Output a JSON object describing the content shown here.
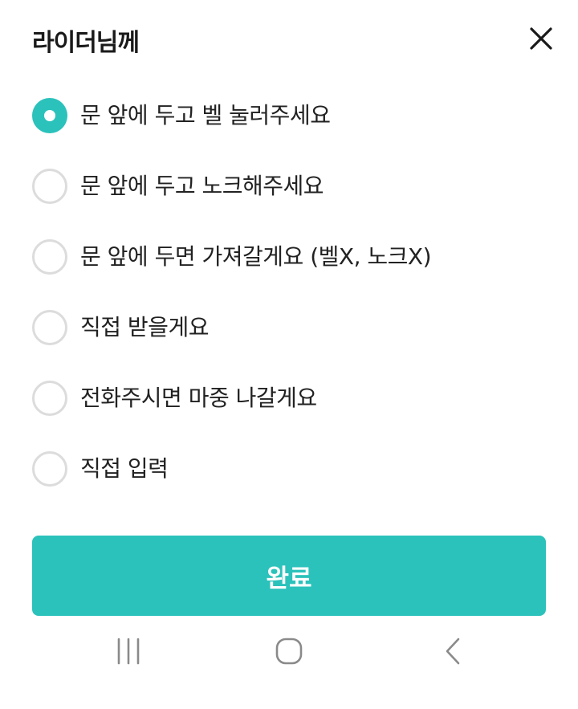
{
  "sheet": {
    "title": "라이더님께",
    "close_icon": "close-icon"
  },
  "options": [
    {
      "label": "문 앞에 두고 벨 눌러주세요",
      "selected": true
    },
    {
      "label": "문 앞에 두고 노크해주세요",
      "selected": false
    },
    {
      "label": "문 앞에 두면 가져갈게요 (벨X, 노크X)",
      "selected": false
    },
    {
      "label": "직접 받을게요",
      "selected": false
    },
    {
      "label": "전화주시면 마중 나갈게요",
      "selected": false
    },
    {
      "label": "직접 입력",
      "selected": false
    }
  ],
  "confirm": {
    "label": "완료"
  },
  "navbar": {
    "recents_icon": "recents-icon",
    "home_icon": "home-icon",
    "back_icon": "back-icon"
  },
  "colors": {
    "accent": "#2bc2bb",
    "radio_border": "#dcdcdc",
    "text": "#222222"
  }
}
